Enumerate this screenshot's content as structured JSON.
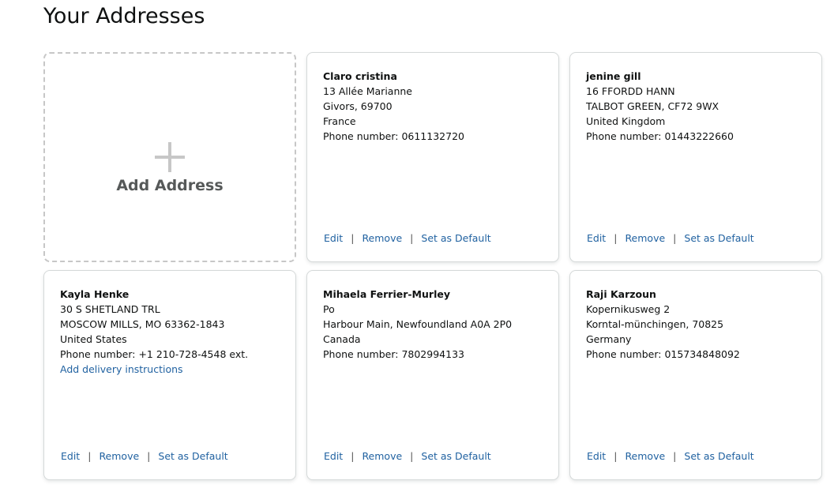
{
  "page": {
    "title": "Your Addresses"
  },
  "add_card": {
    "label": "Add Address",
    "icon": "plus-icon"
  },
  "action_labels": {
    "edit": "Edit",
    "remove": "Remove",
    "set_default": "Set as Default",
    "separator": "|"
  },
  "addresses": [
    {
      "name": "Claro cristina",
      "line1": "13 Allée Marianne",
      "line2": "Givors, 69700",
      "country": "France",
      "phone": "Phone number: 0611132720"
    },
    {
      "name": "jenine gill",
      "line1": "16 FFORDD HANN",
      "line2": "TALBOT GREEN, CF72 9WX",
      "country": "United Kingdom",
      "phone": "Phone number: 01443222660"
    },
    {
      "name": "Kayla Henke",
      "line1": "30 S SHETLAND TRL",
      "line2": "MOSCOW MILLS, MO 63362-1843",
      "country": "United States",
      "phone": "Phone number: +1 210-728-4548 ext.",
      "delivery_instructions": "Add delivery instructions"
    },
    {
      "name": "Mihaela Ferrier-Murley",
      "line1": "Po",
      "line2": "Harbour Main, Newfoundland A0A 2P0",
      "country": "Canada",
      "phone": "Phone number: 7802994133"
    },
    {
      "name": "Raji Karzoun",
      "line1": "Kopernikusweg 2",
      "line2": "Korntal-münchingen, 70825",
      "country": "Germany",
      "phone": "Phone number: 015734848092"
    }
  ],
  "colors": {
    "link": "#2162a1",
    "text": "#0f1111",
    "muted": "#565959",
    "card_border": "#d5d9d9",
    "dashed_border": "#c7c7c7"
  }
}
